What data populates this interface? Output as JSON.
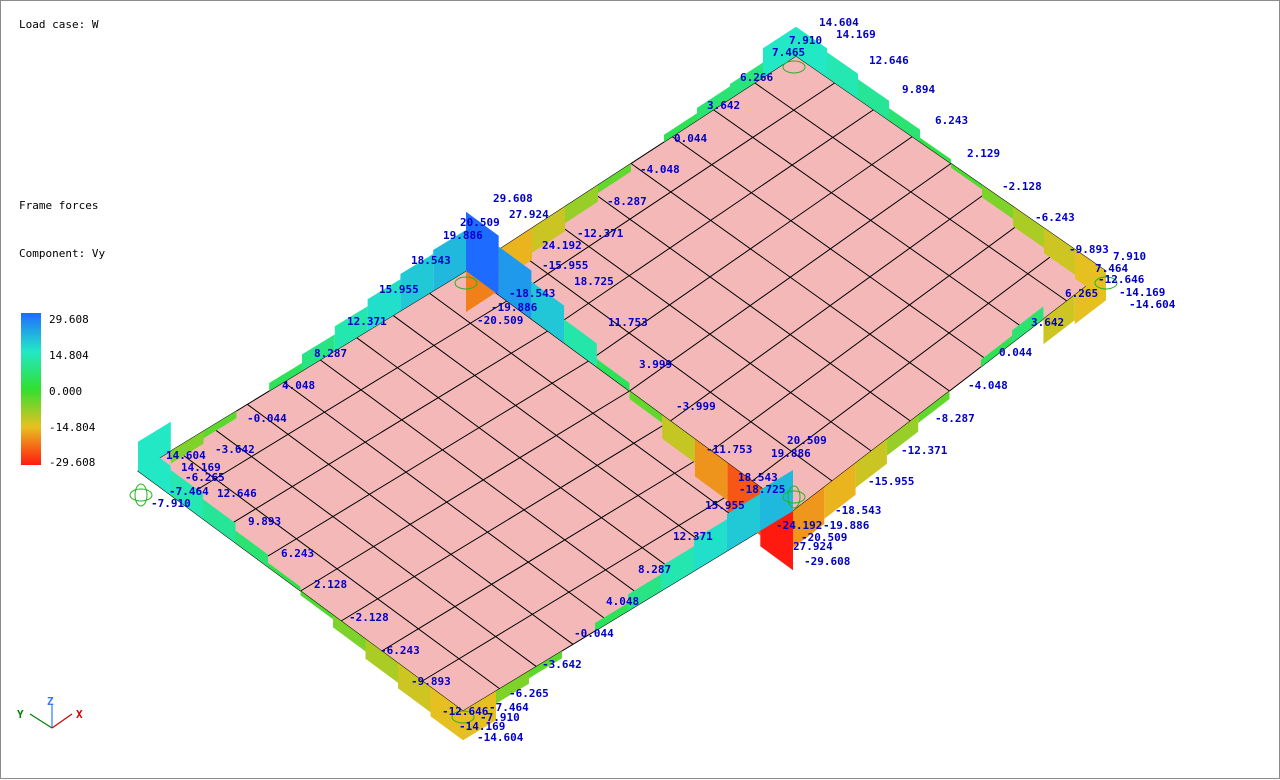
{
  "load_case_label": "Load case: W",
  "result_title": "Frame forces",
  "component_label": "Component: Vy",
  "legend": {
    "values": [
      "29.608",
      "14.804",
      "0.000",
      "-14.804",
      "-29.608"
    ],
    "colors": [
      "#1e6cff",
      "#22e8c8",
      "#30e030",
      "#e8c020",
      "#ff1a10"
    ]
  },
  "axes": {
    "x": "X",
    "y": "Y",
    "z": "Z"
  },
  "colors": {
    "label": "#0000c8",
    "slab": "#f4b8b8",
    "grid_line": "#000000"
  },
  "diagram_labels": [
    "14.604",
    "14.169",
    "7.910",
    "7.465",
    "12.646",
    "6.266",
    "9.894",
    "3.642",
    "6.243",
    "0.044",
    "2.129",
    "-4.048",
    "-2.128",
    "-8.287",
    "-6.243",
    "29.608",
    "27.924",
    "-12.371",
    "20.509",
    "19.886",
    "24.192",
    "-9.893",
    "-15.955",
    "7.910",
    "18.543",
    "18.725",
    "-18.543",
    "7.464",
    "-12.646",
    "15.955",
    "-19.886",
    "-14.169",
    "-20.509",
    "-14.604",
    "12.371",
    "11.753",
    "6.265",
    "3.642",
    "8.287",
    "0.044",
    "3.999",
    "4.048",
    "-4.048",
    "-0.044",
    "-3.999",
    "-8.287",
    "-3.642",
    "20.509",
    "14.604",
    "-11.753",
    "19.886",
    "-12.371",
    "14.169",
    "-6.265",
    "18.543",
    "-7.464",
    "-18.725",
    "-15.955",
    "-7.910",
    "12.646",
    "15.955",
    "-24.192",
    "-19.886",
    "-18.543",
    "9.893",
    "-20.509",
    "12.371",
    "27.924",
    "6.243",
    "-29.608",
    "8.287",
    "2.128",
    "4.048",
    "-2.128",
    "-0.044",
    "-6.243",
    "-3.642",
    "-9.893",
    "-6.265",
    "-12.646",
    "-7.464",
    "-7.910",
    "-14.169",
    "-14.604"
  ]
}
